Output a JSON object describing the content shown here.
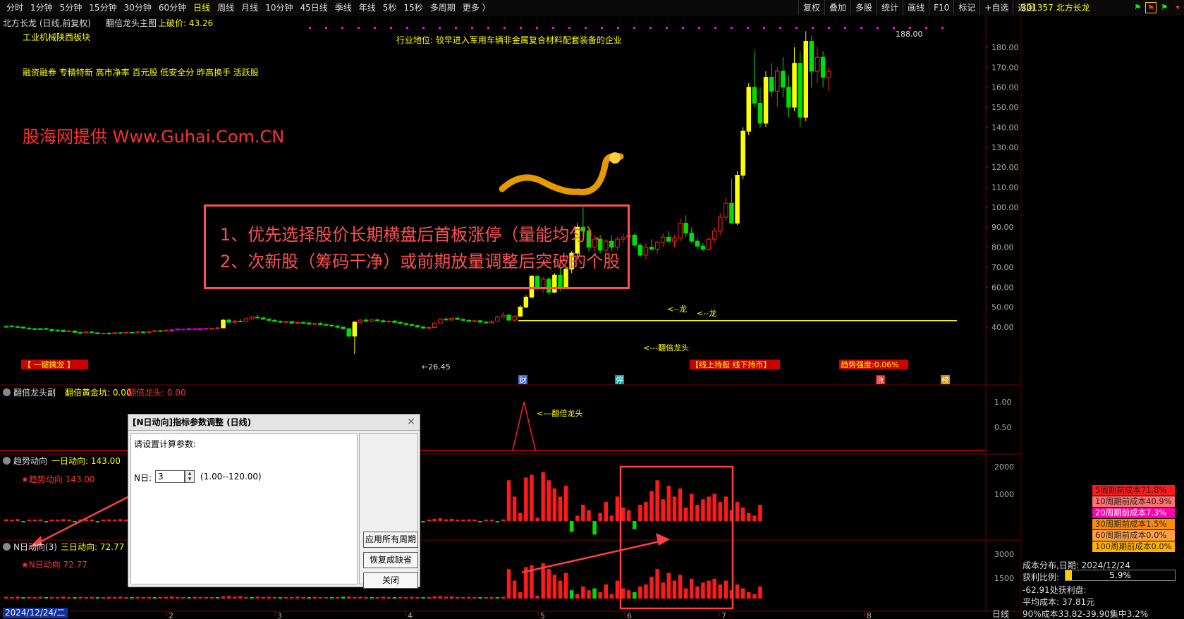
{
  "toolbar": {
    "periods": [
      "分时",
      "1分钟",
      "5分钟",
      "15分钟",
      "30分钟",
      "60分钟",
      "日线",
      "周线",
      "月线",
      "10分钟",
      "45日线",
      "季线",
      "年线",
      "5秒",
      "15秒",
      "多周期",
      "更多 〉"
    ],
    "active_period": "日线",
    "tools": [
      "复权",
      "叠加",
      "多股",
      "统计",
      "画线",
      "F10",
      "标记",
      "+自选",
      "返回"
    ],
    "stock": "301357 北方长龙"
  },
  "main": {
    "title": "北方长龙 (日线,前复权)",
    "indicator_name": "翻倍龙头主图",
    "break_price_label": "上破价: 43.26",
    "sector": "工业机械陕西板块",
    "industry": "行业地位: 较早进入军用车辆非金属复合材料配套装备的企业",
    "tags": "融资融券 专精特新 高市净率 百元股 低安全分 昨高换手 活跃股",
    "watermark": "股海网提供 Www.Guhai.Com.CN",
    "notice_line1": "1、优先选择股价长期横盘后首板涨停（量能均匀）、",
    "notice_line2": "2、次新股（筹码干净）或前期放量调整后突破的个股",
    "annotations": {
      "high": "188.00",
      "low": "26.45",
      "dragon1": "<--龙",
      "dragon2": "<--龙",
      "double_head": "<---翻倍龙头",
      "btn_yijian": "【 一键擒龙 】",
      "btn_hold": "【线上持股 线下持币】",
      "trend_strength": "趋势强度:0.06%",
      "markers": [
        "财",
        "停",
        "涨",
        "榜"
      ]
    }
  },
  "sub1": {
    "name": "翻倍龙头副",
    "v1": "翻倍黄金坑: 0.00",
    "v2": "翻倍龙头: 0.00",
    "spike_label": "<---翻倍龙头"
  },
  "sub2": {
    "name": "趋势动向",
    "v1": "一日动向: 143.00",
    "star": "★趋势动向 143.00"
  },
  "sub3": {
    "name": "N日动向(3)",
    "v1": "三日动向: 72.77",
    "star": "★N日动向 72.77"
  },
  "dialog": {
    "title": "[N日动向]指标参数调整 (日线)",
    "prompt": "请设置计算参数:",
    "n_label": "N日:",
    "n_value": "3",
    "range": "(1.00--120.00)",
    "btn_apply": "应用所有周期",
    "btn_restore": "恢复成缺省",
    "btn_close": "关闭"
  },
  "right_panel": {
    "costs": [
      {
        "label": "5周期前成本71.8%",
        "bg": "#ff1a1a"
      },
      {
        "label": "10周期前成本40.9%",
        "bg": "#ff7070"
      },
      {
        "label": "20周期前成本7.3%",
        "bg": "#ff00aa"
      },
      {
        "label": "30周期前成本1.5%",
        "bg": "#ff8c00"
      },
      {
        "label": "60周期前成本0.0%",
        "bg": "#ffa040"
      },
      {
        "label": "100周期前成本0.0%",
        "bg": "#ffb000"
      }
    ],
    "dist_date": "成本分布,日期: 2024/12/24",
    "profit_ratio_label": "获利比例:",
    "profit_ratio": "5.9%",
    "profit_ratio_value": 0.059,
    "profit_curve": "-62.91处获利盘:",
    "avg_cost": "平均成本: 37.81元",
    "concentration": "90%成本33.82-39.90集中3.2%"
  },
  "date_bar": "2024/12/24/二",
  "bottom_tab": "日线",
  "axes": {
    "price_ticks": [
      40,
      50,
      60,
      70,
      80,
      90,
      100,
      110,
      120,
      130,
      140,
      150,
      160,
      170,
      180
    ],
    "sub1_ticks": [
      "1.00",
      "0.50"
    ],
    "sub2_ticks": [
      "2000",
      "1000"
    ],
    "sub3_ticks": [
      "3000",
      "1500"
    ],
    "x_ticks": [
      "2",
      "3",
      "4",
      "5",
      "6",
      "7",
      "8"
    ]
  },
  "chart_data": {
    "type": "candlestick",
    "candles": [
      [
        40,
        41,
        39.5,
        40.5
      ],
      [
        40.5,
        41,
        40,
        40.2
      ],
      [
        40.2,
        40.8,
        39.6,
        40
      ],
      [
        40,
        40.4,
        39.2,
        39.5
      ],
      [
        39.5,
        40,
        38.8,
        39.2
      ],
      [
        39.2,
        39.6,
        38.5,
        38.8
      ],
      [
        38.8,
        39.5,
        38.5,
        39.3
      ],
      [
        39.3,
        39.8,
        38.7,
        38.9
      ],
      [
        38.9,
        39,
        38,
        38.2
      ],
      [
        38.2,
        38.8,
        37.8,
        38.5
      ],
      [
        38.5,
        38.7,
        37.5,
        37.8
      ],
      [
        37.8,
        38.4,
        37.5,
        38.1
      ],
      [
        38.1,
        38.3,
        37.2,
        37.4
      ],
      [
        37.4,
        37.8,
        36.9,
        37.1
      ],
      [
        37.1,
        37.9,
        36.8,
        37.6
      ],
      [
        37.6,
        37.9,
        37,
        37.2
      ],
      [
        37.2,
        37.4,
        36.5,
        36.7
      ],
      [
        36.7,
        37.2,
        36.4,
        37
      ],
      [
        37,
        37.3,
        36.5,
        36.6
      ],
      [
        36.6,
        37.4,
        36.5,
        37.2
      ],
      [
        37.2,
        37.5,
        36.8,
        37
      ],
      [
        37,
        37.6,
        36.9,
        37.4
      ],
      [
        37.4,
        37.5,
        36.8,
        37.1
      ],
      [
        37.1,
        37.8,
        37,
        37.6
      ],
      [
        37.6,
        37.9,
        37.1,
        37.3
      ],
      [
        37.3,
        38,
        37.2,
        37.8
      ],
      [
        37.8,
        38.4,
        37.5,
        38.2
      ],
      [
        38.2,
        38.5,
        37.8,
        38
      ],
      [
        38,
        38.7,
        37.9,
        38.5
      ],
      [
        38.5,
        39,
        38.2,
        38.6
      ],
      [
        38.6,
        39.2,
        38.4,
        39
      ],
      [
        39,
        39.3,
        38.6,
        38.8
      ],
      [
        38.8,
        39.5,
        38.7,
        39.2
      ],
      [
        39.2,
        39.4,
        38.5,
        38.7
      ],
      [
        38.7,
        39.6,
        38.6,
        39.4
      ],
      [
        39.4,
        39.6,
        38.9,
        39.1
      ],
      [
        39.1,
        39.5,
        38.8,
        39.3
      ],
      [
        39.3,
        40.2,
        39.1,
        39.6
      ],
      [
        39.6,
        44,
        39.5,
        43.5
      ],
      [
        43.5,
        44.5,
        42,
        42.5
      ],
      [
        42.5,
        43.5,
        41.8,
        43
      ],
      [
        43,
        44.2,
        42.5,
        42.8
      ],
      [
        42.8,
        44.8,
        42.6,
        44.2
      ],
      [
        44.2,
        45.5,
        43.5,
        45
      ],
      [
        45,
        46,
        44.2,
        44.6
      ],
      [
        44.6,
        45.2,
        43.6,
        44
      ],
      [
        44,
        44.5,
        43,
        43.4
      ],
      [
        43.4,
        44,
        42.6,
        42.9
      ],
      [
        42.9,
        43.3,
        42,
        42.5
      ],
      [
        42.5,
        43.2,
        42,
        42.8
      ],
      [
        42.8,
        43,
        41.5,
        42
      ],
      [
        42,
        42.6,
        41.5,
        42.3
      ],
      [
        42.3,
        42.8,
        41.8,
        42.1
      ],
      [
        42.1,
        42.4,
        41.2,
        41.5
      ],
      [
        41.5,
        42,
        40.8,
        41.8
      ],
      [
        41.8,
        42.5,
        41.2,
        41.3
      ],
      [
        41.3,
        41.8,
        40.6,
        41
      ],
      [
        41,
        41.4,
        40.2,
        40.5
      ],
      [
        40.5,
        41,
        39.5,
        40
      ],
      [
        40,
        40.4,
        38.8,
        39.2
      ],
      [
        39.2,
        39.6,
        35,
        35.5
      ],
      [
        35.5,
        43,
        26.45,
        42.5
      ],
      [
        42.5,
        44,
        41.5,
        43.5
      ],
      [
        43.5,
        44.5,
        42.6,
        43
      ],
      [
        43,
        44,
        42.5,
        43.6
      ],
      [
        43.6,
        44.3,
        42.8,
        43.2
      ],
      [
        43.2,
        43.8,
        42.3,
        42.6
      ],
      [
        42.6,
        43.4,
        42.2,
        43
      ],
      [
        43,
        43.6,
        42.2,
        42.4
      ],
      [
        42.4,
        42.9,
        41.5,
        41.8
      ],
      [
        41.8,
        42.4,
        41,
        41.3
      ],
      [
        41.3,
        41.8,
        40.5,
        40.8
      ],
      [
        40.8,
        41.2,
        39.8,
        40.1
      ],
      [
        40.1,
        40.6,
        39.2,
        39.5
      ],
      [
        39.5,
        40.2,
        39,
        39.8
      ],
      [
        39.8,
        42.5,
        39.6,
        42
      ],
      [
        42,
        44.5,
        41.8,
        44
      ],
      [
        44,
        45,
        43.2,
        43.6
      ],
      [
        43.6,
        44.8,
        43,
        44.4
      ],
      [
        44.4,
        45.2,
        43.5,
        43.9
      ],
      [
        43.9,
        44.5,
        43,
        43.4
      ],
      [
        43.4,
        44,
        42.6,
        42.9
      ],
      [
        42.9,
        43.6,
        42.4,
        43.2
      ],
      [
        43.2,
        43.5,
        42.2,
        42.5
      ],
      [
        42.5,
        43,
        41.8,
        42.2
      ],
      [
        42.2,
        43.5,
        42,
        43
      ],
      [
        43,
        45.5,
        42.8,
        45
      ],
      [
        45,
        47.5,
        44.5,
        46
      ],
      [
        46,
        46.5,
        43,
        43.5
      ],
      [
        43.5,
        46,
        43,
        45.5
      ],
      [
        45.5,
        51,
        45,
        50
      ],
      [
        50,
        56,
        49.5,
        55
      ],
      [
        55,
        66,
        54.5,
        65.5
      ],
      [
        65.5,
        66,
        58,
        59.5
      ],
      [
        59.5,
        65,
        57,
        64
      ],
      [
        64,
        65,
        56,
        57.5
      ],
      [
        57.5,
        67,
        57,
        66
      ],
      [
        66,
        70,
        58,
        60
      ],
      [
        60,
        70,
        59,
        69
      ],
      [
        69,
        78,
        67,
        77
      ],
      [
        77,
        92,
        75,
        90
      ],
      [
        90,
        100,
        85,
        88
      ],
      [
        88,
        89,
        78,
        80
      ],
      [
        80,
        86,
        78,
        84
      ],
      [
        84,
        86,
        77,
        78.5
      ],
      [
        78.5,
        84,
        77,
        83
      ],
      [
        83,
        86,
        78,
        80
      ],
      [
        80,
        85,
        78.5,
        84
      ],
      [
        84,
        87,
        82,
        85
      ],
      [
        85,
        88,
        82,
        86
      ],
      [
        86,
        87,
        80,
        81
      ],
      [
        81,
        82,
        75,
        76
      ],
      [
        76,
        82,
        74,
        80
      ],
      [
        80,
        84,
        78,
        79
      ],
      [
        79,
        83,
        77,
        82.5
      ],
      [
        82.5,
        87,
        80,
        85
      ],
      [
        85,
        88,
        82,
        83
      ],
      [
        83,
        86,
        80,
        84.5
      ],
      [
        84.5,
        94,
        83,
        92
      ],
      [
        92,
        96,
        85,
        87
      ],
      [
        87,
        90,
        82,
        83
      ],
      [
        83,
        85,
        79,
        80.5
      ],
      [
        80.5,
        82,
        78,
        79
      ],
      [
        79,
        85,
        78.5,
        84
      ],
      [
        84,
        90,
        82,
        88
      ],
      [
        88,
        97,
        86,
        95
      ],
      [
        95,
        105,
        93,
        102
      ],
      [
        102,
        114,
        100,
        92
      ],
      [
        92,
        118,
        91,
        116
      ],
      [
        116,
        140,
        114,
        138
      ],
      [
        138,
        162,
        136,
        160
      ],
      [
        160,
        178,
        150,
        152
      ],
      [
        152,
        160,
        140,
        142
      ],
      [
        142,
        168,
        140,
        165
      ],
      [
        165,
        172,
        155,
        158
      ],
      [
        158,
        170,
        150,
        168
      ],
      [
        168,
        175,
        155,
        160
      ],
      [
        160,
        166,
        145,
        150
      ],
      [
        150,
        180,
        148,
        172
      ],
      [
        172,
        178,
        140,
        145
      ],
      [
        145,
        188,
        143,
        183
      ],
      [
        183,
        186,
        160,
        168
      ],
      [
        168,
        180,
        162,
        175
      ],
      [
        175,
        178,
        160,
        165
      ],
      [
        165,
        170,
        158,
        168
      ]
    ],
    "line_y": 43.26,
    "sub2_values": [
      60,
      40,
      70,
      -30,
      50,
      30,
      60,
      -40,
      50,
      40,
      70,
      30,
      -20,
      60,
      40,
      50,
      -30,
      40,
      60,
      50,
      70,
      40,
      -40,
      60,
      30,
      50,
      -20,
      40,
      60,
      80,
      50,
      40,
      -30,
      60,
      40,
      50,
      30,
      -20,
      80,
      100,
      60,
      90,
      40,
      -50,
      70,
      50,
      60,
      40,
      -30,
      50,
      40,
      70,
      30,
      -20,
      60,
      40,
      30,
      -40,
      50,
      -60,
      80,
      40,
      60,
      50,
      -20,
      40,
      60,
      30,
      -30,
      50,
      40,
      60,
      30,
      -40,
      50,
      80,
      100,
      60,
      80,
      50,
      40,
      60,
      30,
      -20,
      40,
      50,
      -30,
      60,
      1500,
      900,
      300,
      1600,
      1700,
      120,
      1800,
      1500,
      1200,
      900,
      1300,
      -400,
      200,
      600,
      400,
      -500,
      300,
      700,
      200,
      900,
      500,
      400,
      -300,
      600,
      700,
      1100,
      1500,
      800,
      1300,
      900,
      1200,
      500,
      1000,
      600,
      800,
      900,
      1000,
      700,
      900,
      400,
      700,
      500,
      300,
      200,
      600
    ]
  }
}
